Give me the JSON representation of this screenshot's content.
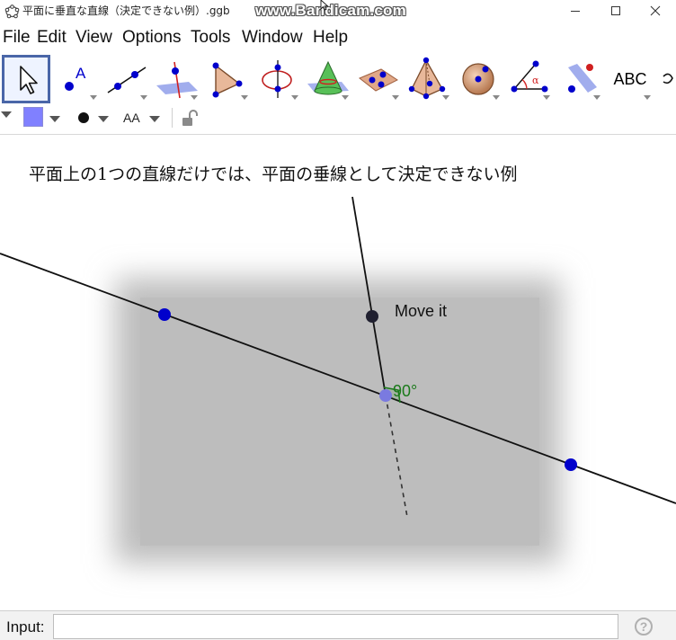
{
  "window": {
    "title": "平面に垂直な直線（決定できない例）.ggb",
    "watermark": "www.Bandicam.com"
  },
  "menu": {
    "items": [
      "File",
      "Edit",
      "View",
      "Options",
      "Tools",
      "Window",
      "Help"
    ]
  },
  "toolbar": {
    "text_tool_label": "ABC",
    "tools": [
      {
        "name": "move-tool-icon",
        "selected": true
      },
      {
        "name": "point-tool-icon"
      },
      {
        "name": "line-tool-icon"
      },
      {
        "name": "perpendicular-line-tool-icon"
      },
      {
        "name": "polygon-tool-icon"
      },
      {
        "name": "circle-axis-tool-icon"
      },
      {
        "name": "intersect-surfaces-tool-icon"
      },
      {
        "name": "plane-through-points-tool-icon"
      },
      {
        "name": "pyramid-tool-icon"
      },
      {
        "name": "sphere-tool-icon"
      },
      {
        "name": "angle-tool-icon"
      },
      {
        "name": "reflect-about-plane-tool-icon"
      },
      {
        "name": "text-tool-icon"
      },
      {
        "name": "rotate-view-tool-icon"
      }
    ]
  },
  "stylebar": {
    "color": "#8080ff",
    "text_size_label": "AA"
  },
  "graphics": {
    "caption": "平面上の1つの直線だけでは、平面の垂線として決定できない例",
    "point_label": "Move it",
    "angle_label": "90°",
    "colors": {
      "plane": "#bdbdbd",
      "point_blue": "#0000cc",
      "point_dark": "#202030",
      "point_intersection": "#7a7ae0",
      "angle_mark": "#1a7a1a"
    }
  },
  "input": {
    "label": "Input:",
    "value": "",
    "help_symbol": "?"
  }
}
